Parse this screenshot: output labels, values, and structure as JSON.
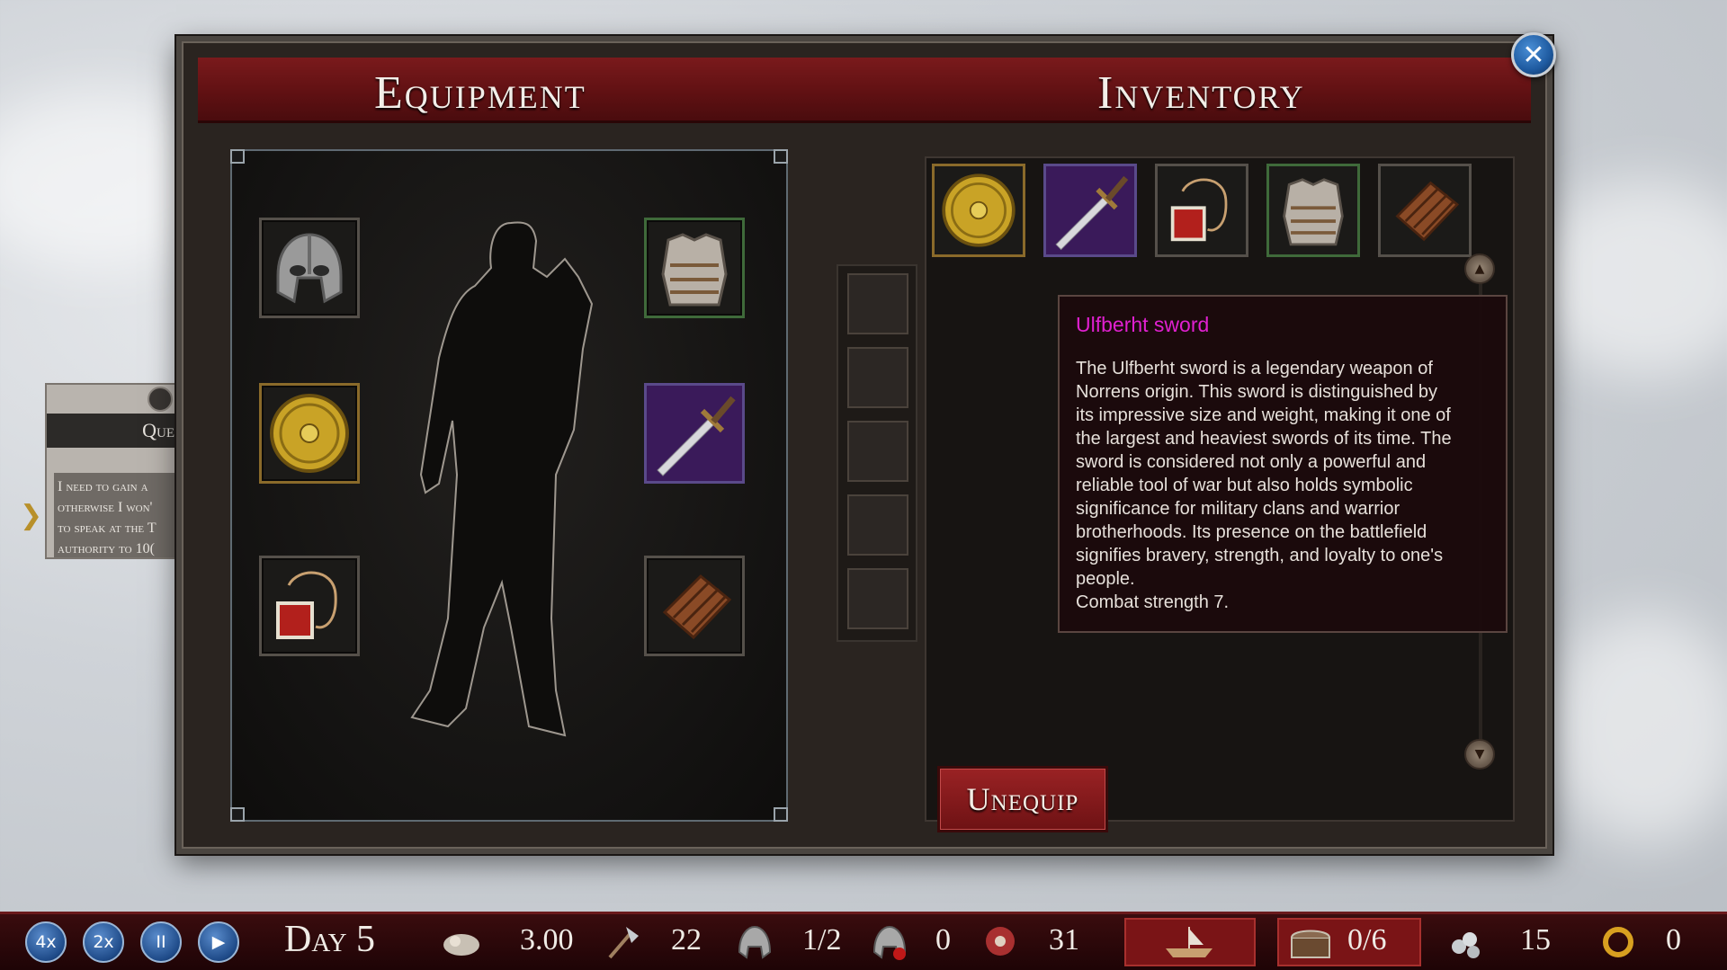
{
  "header": {
    "equipment_title": "Equipment",
    "inventory_title": "Inventory"
  },
  "close_button": {
    "glyph": "✕"
  },
  "equipment_slots": [
    {
      "name": "helmet-slot",
      "item": "helmet"
    },
    {
      "name": "body-armor-slot",
      "item": "chest armor"
    },
    {
      "name": "shield-slot",
      "item": "round shield"
    },
    {
      "name": "weapon-slot",
      "item": "Ulfberht sword"
    },
    {
      "name": "amulet-slot",
      "item": "amulet"
    },
    {
      "name": "raft-slot",
      "item": "wooden raft"
    }
  ],
  "inventory": {
    "items": [
      "round shield",
      "Ulfberht sword",
      "amulet",
      "chest armor",
      "wooden raft"
    ],
    "unequip_label": "Unequip",
    "scroll_up": "▲",
    "scroll_down": "▼"
  },
  "tooltip": {
    "title": "Ulfberht sword",
    "description": "The Ulfberht sword is a legendary weapon of\nNorrens origin. This sword is distinguished by\nits impressive size and weight, making it one of\nthe largest and heaviest swords of its time. The\nsword is considered not only a powerful and\nreliable tool of war but also holds symbolic\nsignificance for military clans and warrior\nbrotherhoods. Its presence on the battlefield\nsignifies bravery, strength, and loyalty to one's\npeople.\nCombat strength 7.",
    "title_color": "#e020d0"
  },
  "quest": {
    "header": "Que",
    "text": "I need to gain a\notherwise I won'\nto speak at the T\nauthority to 10(",
    "arrow": "❯"
  },
  "bottom_bar": {
    "speed_4x": "4x",
    "speed_2x": "2x",
    "pause": "II",
    "play": "▶",
    "day": "Day 5",
    "food_rate": "3.00",
    "tools": "22",
    "soldiers": "1/2",
    "wounded": "0",
    "meat": "31",
    "chests": "0/6",
    "silver": "15",
    "last": "0"
  },
  "colors": {
    "header_red": "#6e1214",
    "tooltip_bg": "#1c0a0c",
    "button_blue": "#1e5aa0"
  }
}
